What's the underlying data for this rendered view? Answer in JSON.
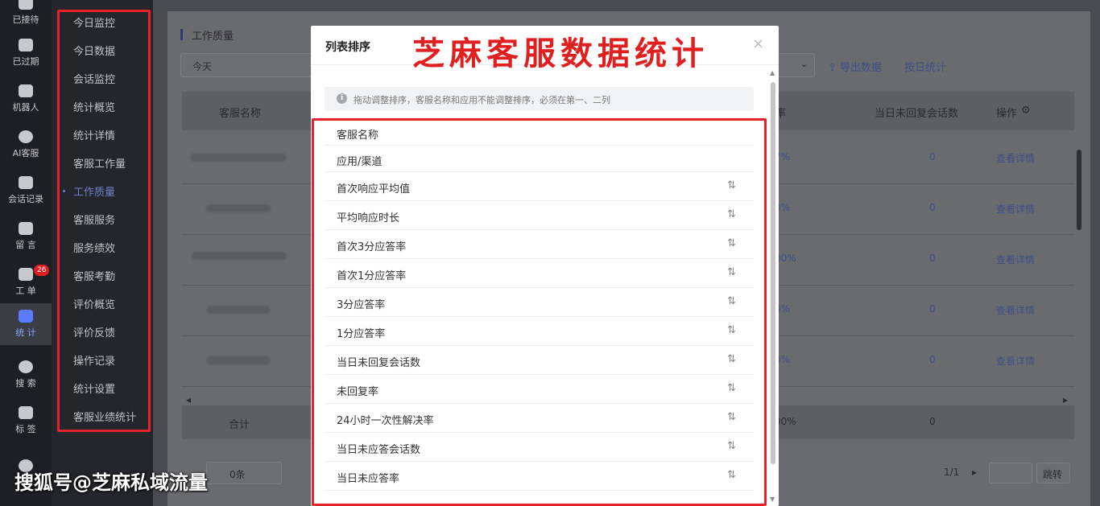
{
  "rail": [
    {
      "label": "已接待",
      "icon": "chat-received-icon"
    },
    {
      "label": "已过期",
      "icon": "expired-icon"
    },
    {
      "label": "机器人",
      "icon": "robot-icon"
    },
    {
      "label": "AI客服",
      "icon": "ai-service-icon"
    },
    {
      "label": "会话记录",
      "icon": "chat-record-icon"
    },
    {
      "label": "留 言",
      "icon": "message-icon"
    },
    {
      "label": "工 单",
      "icon": "ticket-icon",
      "badge": "26"
    },
    {
      "label": "统 计",
      "icon": "stats-icon",
      "active": true
    },
    {
      "label": "搜 索",
      "icon": "search-icon"
    },
    {
      "label": "标 签",
      "icon": "tag-icon"
    }
  ],
  "submenu": [
    "今日监控",
    "今日数据",
    "会话监控",
    "统计概览",
    "统计详情",
    "客服工作量",
    "工作质量",
    "客服服务",
    "服务绩效",
    "客服考勤",
    "评价概览",
    "评价反馈",
    "操作记录",
    "统计设置",
    "客服业绩统计"
  ],
  "submenu_active_index": 6,
  "main": {
    "section_title": "工作质量",
    "date_select": "今天",
    "export_label": "导出数据",
    "by_day_label": "按日统计",
    "headers": {
      "name": "客服名称",
      "rate": "率",
      "unreplied": "当日未回复会话数",
      "action": "操作"
    },
    "rows": [
      {
        "pct": "7%",
        "zero": "0",
        "action": "查看详情"
      },
      {
        "pct": "0%",
        "zero": "0",
        "action": "查看详情"
      },
      {
        "pct": "00%",
        "zero": "0",
        "action": "查看详情"
      },
      {
        "pct": "0%",
        "zero": "0",
        "action": "查看详情"
      },
      {
        "pct": "0%",
        "zero": "0",
        "action": "查看详情"
      }
    ],
    "total": {
      "label": "合计",
      "pct": "00%",
      "zero": "0"
    },
    "pager": {
      "per_page": "0条",
      "page": "1/1",
      "jump": "跳转"
    }
  },
  "modal": {
    "title": "列表排序",
    "close": "×",
    "tip": "拖动调整排序，客服名称和应用不能调整排序，必须在第一、二列",
    "sort_icon": "⇅",
    "fixed_items": [
      "客服名称",
      "应用/渠道"
    ],
    "sortable_items": [
      "首次响应平均值",
      "平均响应时长",
      "首次3分应答率",
      "首次1分应答率",
      "3分应答率",
      "1分应答率",
      "当日未回复会话数",
      "未回复率",
      "24小时一次性解决率",
      "当日未应答会话数",
      "当日未应答率"
    ]
  },
  "overlay_title": "芝麻客服数据统计",
  "watermark": "搜狐号@芝麻私域流量",
  "colors": {
    "highlight": "#e5232b",
    "accent": "#5a7bff"
  }
}
